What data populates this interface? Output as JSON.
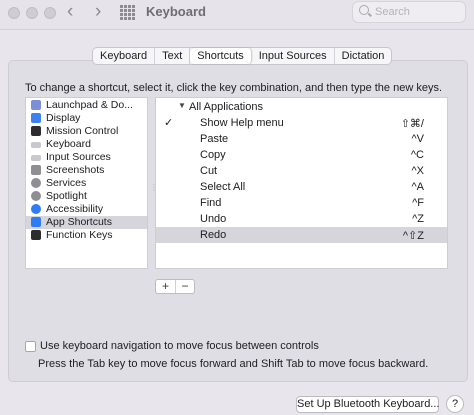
{
  "window": {
    "title": "Keyboard",
    "search_placeholder": "Search"
  },
  "tabs": [
    {
      "label": "Keyboard",
      "active": false
    },
    {
      "label": "Text",
      "active": false
    },
    {
      "label": "Shortcuts",
      "active": true
    },
    {
      "label": "Input Sources",
      "active": false
    },
    {
      "label": "Dictation",
      "active": false
    }
  ],
  "instructions": "To change a shortcut, select it, click the key combination, and then type the new keys.",
  "categories": [
    {
      "label": "Launchpad & Do...",
      "icon": "launchpad-icon",
      "color": "#7a8fd8",
      "selected": false
    },
    {
      "label": "Display",
      "icon": "display-icon",
      "color": "#3b82f0",
      "selected": false
    },
    {
      "label": "Mission Control",
      "icon": "mission-control-icon",
      "color": "#2c2c2e",
      "selected": false
    },
    {
      "label": "Keyboard",
      "icon": "keyboard-icon",
      "color": "#c9c8cd",
      "selected": false
    },
    {
      "label": "Input Sources",
      "icon": "input-sources-icon",
      "color": "#c9c8cd",
      "selected": false
    },
    {
      "label": "Screenshots",
      "icon": "screenshots-icon",
      "color": "#8e8e93",
      "selected": false
    },
    {
      "label": "Services",
      "icon": "services-icon",
      "color": "#8e8e93",
      "selected": false
    },
    {
      "label": "Spotlight",
      "icon": "spotlight-icon",
      "color": "#8e8e93",
      "selected": false
    },
    {
      "label": "Accessibility",
      "icon": "accessibility-icon",
      "color": "#2f7cf6",
      "selected": false
    },
    {
      "label": "App Shortcuts",
      "icon": "app-shortcuts-icon",
      "color": "#2f7cf6",
      "selected": true
    },
    {
      "label": "Function Keys",
      "icon": "function-keys-icon",
      "color": "#2c2c2e",
      "selected": false
    }
  ],
  "shortcuts": {
    "group_label": "All Applications",
    "items": [
      {
        "checked": true,
        "name": "Show Help menu",
        "keys": "⇧⌘/"
      },
      {
        "checked": false,
        "name": "Paste",
        "keys": "^V"
      },
      {
        "checked": false,
        "name": "Copy",
        "keys": "^C"
      },
      {
        "checked": false,
        "name": "Cut",
        "keys": "^X"
      },
      {
        "checked": false,
        "name": "Select All",
        "keys": "^A"
      },
      {
        "checked": false,
        "name": "Find",
        "keys": "^F"
      },
      {
        "checked": false,
        "name": "Undo",
        "keys": "^Z"
      },
      {
        "checked": false,
        "name": "Redo",
        "keys": "^⇧Z",
        "selected": true
      }
    ]
  },
  "buttons": {
    "add": "+",
    "remove": "−",
    "bluetooth": "Set Up Bluetooth Keyboard...",
    "help": "?"
  },
  "keyboard_navigation": {
    "label": "Use keyboard navigation to move focus between controls",
    "hint": "Press the Tab key to move focus forward and Shift Tab to move focus backward.",
    "checked": false
  }
}
